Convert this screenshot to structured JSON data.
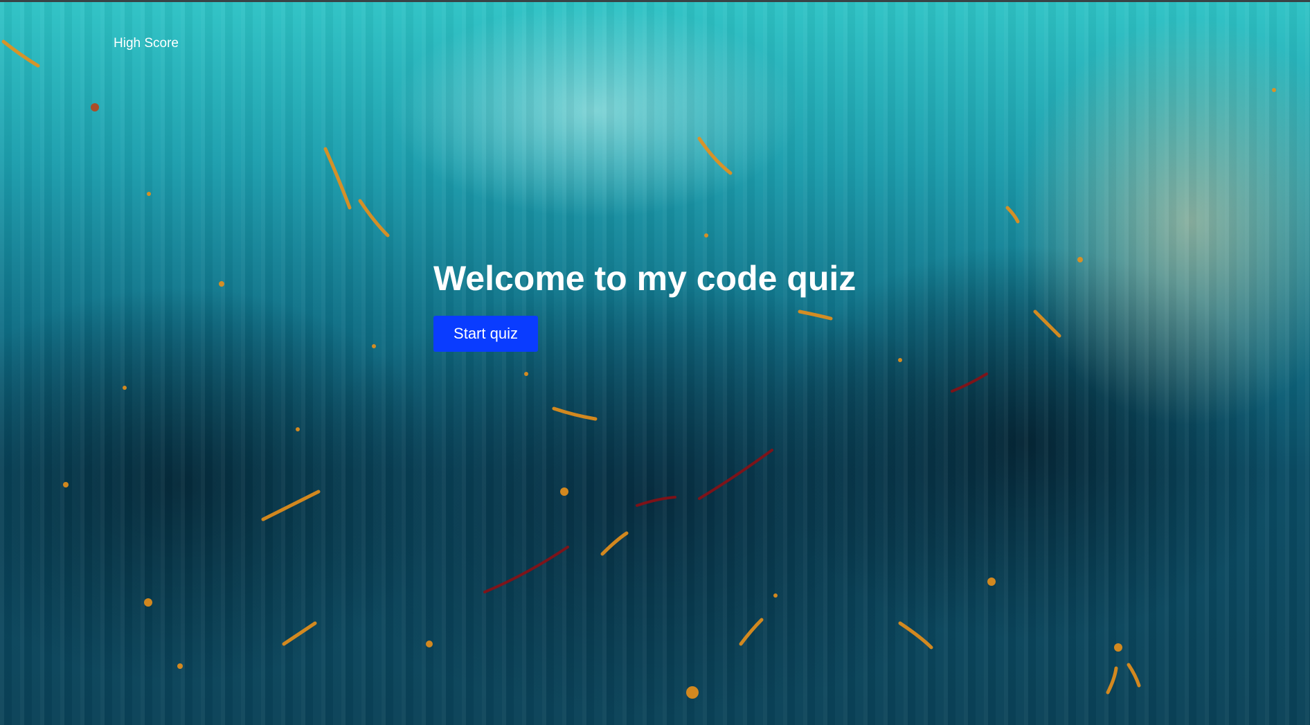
{
  "nav": {
    "high_score_label": "High Score"
  },
  "hero": {
    "title": "Welcome to my code quiz",
    "start_button_label": "Start quiz"
  },
  "colors": {
    "button_background": "#0a3cff",
    "text": "#ffffff",
    "background_teal": "#1d9fae",
    "background_dark": "#0a4258",
    "splatter_orange": "#e8901a",
    "splatter_red": "#8a0f14"
  }
}
